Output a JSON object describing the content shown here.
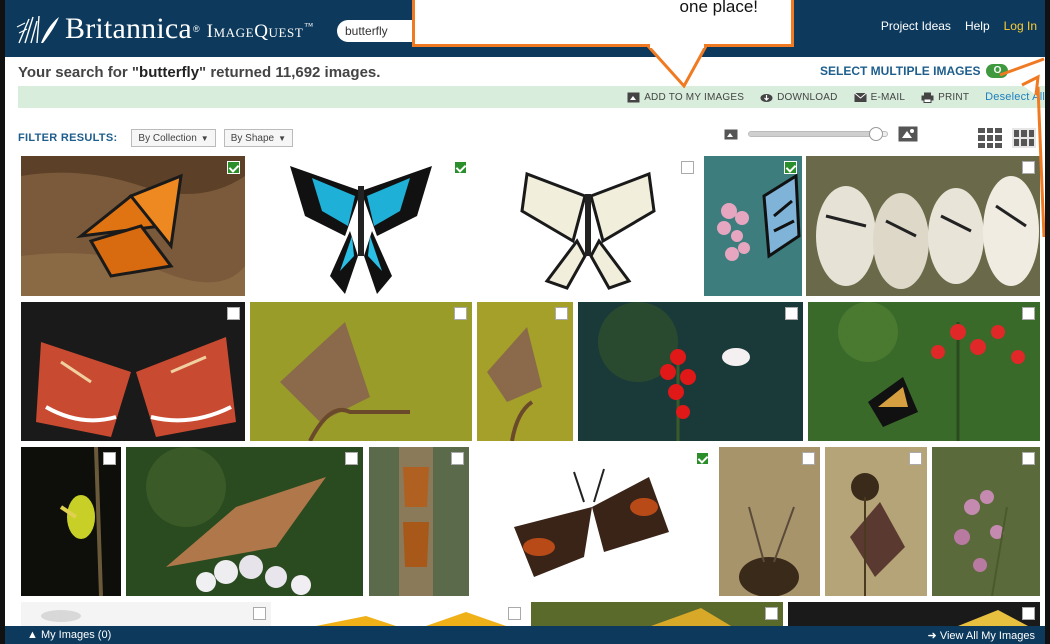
{
  "header": {
    "brand": "Britannica",
    "product": "ImageQuest",
    "trademark": "™",
    "search_value": "butterfly",
    "nav": {
      "project_ideas": "Project Ideas",
      "help": "Help",
      "login": "Log In"
    }
  },
  "callout": {
    "text": "one place!"
  },
  "results": {
    "prefix": "Your search for \"",
    "query": "butterfly",
    "suffix": "\" returned 11,692 images."
  },
  "select_multiple": {
    "label": "SELECT MULTIPLE IMAGES",
    "state": "O"
  },
  "toolbar": {
    "add_to_my_images": "ADD TO MY IMAGES",
    "download": "DOWNLOAD",
    "email": "E-MAIL",
    "print": "PRINT",
    "deselect_all": "Deselect All"
  },
  "filter": {
    "label": "FILTER RESULTS:",
    "collection": "By Collection",
    "shape": "By Shape"
  },
  "zoom": {
    "level": 0.92
  },
  "grid": {
    "tiles": [
      {
        "id": "monarch-bark",
        "checked": true
      },
      {
        "id": "blue-swallowtail",
        "checked": true
      },
      {
        "id": "white-swallowtail",
        "checked": false
      },
      {
        "id": "blue-tiger-flowers",
        "checked": true
      },
      {
        "id": "paper-kite-cluster",
        "checked": false
      },
      {
        "id": "leopard-lacewing",
        "checked": false
      },
      {
        "id": "brown-butterfly-twig",
        "checked": false
      },
      {
        "id": "brown-butterfly-twig-small",
        "checked": false
      },
      {
        "id": "white-on-red-flower",
        "checked": false
      },
      {
        "id": "black-orange-on-red-flower",
        "checked": false
      },
      {
        "id": "chrysalis",
        "checked": false
      },
      {
        "id": "fritillary-white-flowers",
        "checked": false
      },
      {
        "id": "tree-trunk-moths",
        "checked": false
      },
      {
        "id": "ringlet",
        "checked": true
      },
      {
        "id": "dry-flower-butterfly",
        "checked": false
      },
      {
        "id": "butterfly-seedhead",
        "checked": false
      },
      {
        "id": "purple-flowers",
        "checked": false
      }
    ]
  },
  "bottom": {
    "my_images": "My Images (0)",
    "view_all": "View All My Images"
  },
  "colors": {
    "header": "#0d3a5c",
    "callout_border": "#f07a22",
    "toolbar_bg": "#d8eddb",
    "accent": "#1e5e8c",
    "check_on": "#2a8f2a"
  }
}
